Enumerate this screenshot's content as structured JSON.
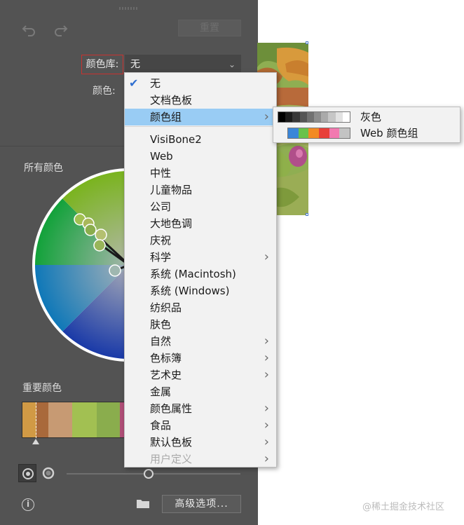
{
  "toolbar": {
    "undo_icon": "undo-icon",
    "redo_icon": "redo-icon",
    "reset_label": "重置"
  },
  "library": {
    "label": "颜色库:",
    "selected": "无",
    "color_label": "颜色:"
  },
  "sections": {
    "all_colors": "所有颜色",
    "key_colors": "重要颜色"
  },
  "key_swatches": [
    "#d19a45",
    "#a9693b",
    "#c79a73",
    "#a2c052",
    "#8aad4d",
    "#b04f77"
  ],
  "bottom": {
    "advanced_label": "高级选项...",
    "info_icon": "info-icon",
    "folder_icon": "folder-icon",
    "slider_value": 0.47
  },
  "menu": {
    "items": [
      {
        "label": "无",
        "checked": true,
        "submenu": false,
        "highlighted": false,
        "disabled": false
      },
      {
        "label": "文档色板",
        "checked": false,
        "submenu": false,
        "highlighted": false,
        "disabled": false
      },
      {
        "label": "颜色组",
        "checked": false,
        "submenu": true,
        "highlighted": true,
        "disabled": false
      },
      {
        "label": "VisiBone2",
        "checked": false,
        "submenu": false,
        "highlighted": false,
        "disabled": false
      },
      {
        "label": "Web",
        "checked": false,
        "submenu": false,
        "highlighted": false,
        "disabled": false
      },
      {
        "label": "中性",
        "checked": false,
        "submenu": false,
        "highlighted": false,
        "disabled": false
      },
      {
        "label": "儿童物品",
        "checked": false,
        "submenu": false,
        "highlighted": false,
        "disabled": false
      },
      {
        "label": "公司",
        "checked": false,
        "submenu": false,
        "highlighted": false,
        "disabled": false
      },
      {
        "label": "大地色调",
        "checked": false,
        "submenu": false,
        "highlighted": false,
        "disabled": false
      },
      {
        "label": "庆祝",
        "checked": false,
        "submenu": false,
        "highlighted": false,
        "disabled": false
      },
      {
        "label": "科学",
        "checked": false,
        "submenu": true,
        "highlighted": false,
        "disabled": false
      },
      {
        "label": "系统 (Macintosh)",
        "checked": false,
        "submenu": false,
        "highlighted": false,
        "disabled": false
      },
      {
        "label": "系统 (Windows)",
        "checked": false,
        "submenu": false,
        "highlighted": false,
        "disabled": false
      },
      {
        "label": "纺织品",
        "checked": false,
        "submenu": false,
        "highlighted": false,
        "disabled": false
      },
      {
        "label": "肤色",
        "checked": false,
        "submenu": false,
        "highlighted": false,
        "disabled": false
      },
      {
        "label": "自然",
        "checked": false,
        "submenu": true,
        "highlighted": false,
        "disabled": false
      },
      {
        "label": "色标簿",
        "checked": false,
        "submenu": true,
        "highlighted": false,
        "disabled": false
      },
      {
        "label": "艺术史",
        "checked": false,
        "submenu": true,
        "highlighted": false,
        "disabled": false
      },
      {
        "label": "金属",
        "checked": false,
        "submenu": false,
        "highlighted": false,
        "disabled": false
      },
      {
        "label": "颜色属性",
        "checked": false,
        "submenu": true,
        "highlighted": false,
        "disabled": false
      },
      {
        "label": "食品",
        "checked": false,
        "submenu": true,
        "highlighted": false,
        "disabled": false
      },
      {
        "label": "默认色板",
        "checked": false,
        "submenu": true,
        "highlighted": false,
        "disabled": false
      },
      {
        "label": "用户定义",
        "checked": false,
        "submenu": true,
        "highlighted": false,
        "disabled": true
      }
    ]
  },
  "submenu": {
    "items": [
      {
        "label": "灰色",
        "colors": [
          "#000000",
          "#1c1c1c",
          "#383838",
          "#555555",
          "#717171",
          "#8d8d8d",
          "#aaaaaa",
          "#c6c6c6",
          "#e2e2e2",
          "#ffffff"
        ]
      },
      {
        "label": "Web 颜色组",
        "colors": [
          "#3a86d8",
          "#69c24a",
          "#f28a24",
          "#e8403a",
          "#f27ab0",
          "#c3c3c3"
        ]
      }
    ]
  },
  "watermark": "@稀土掘金技术社区"
}
